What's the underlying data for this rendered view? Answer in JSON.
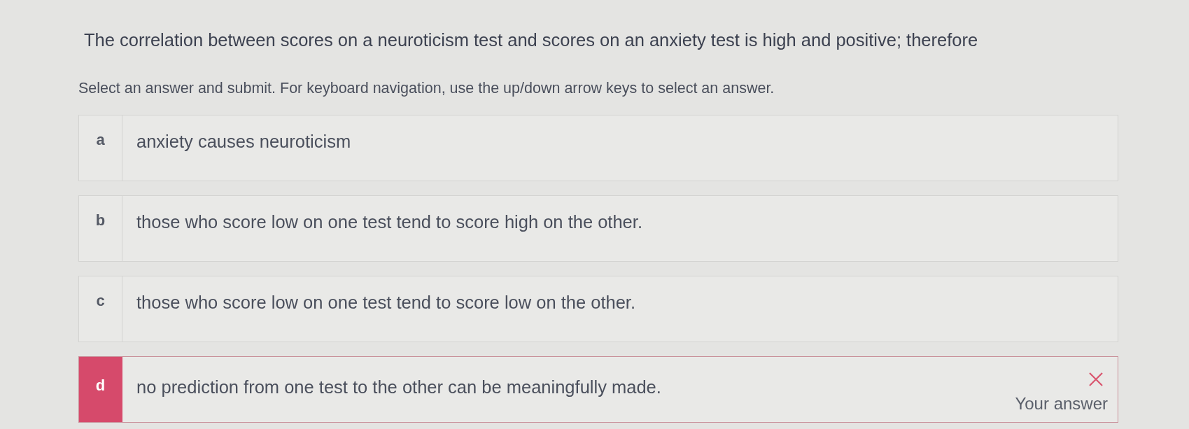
{
  "question": "The correlation between scores on a neuroticism test and scores on an anxiety test is high and positive; therefore",
  "instructions": "Select an answer and submit. For keyboard navigation, use the up/down arrow keys to select an answer.",
  "options": [
    {
      "letter": "a",
      "text": "anxiety causes neuroticism",
      "selected": false
    },
    {
      "letter": "b",
      "text": "those who score low on one test tend to score high on the other.",
      "selected": false
    },
    {
      "letter": "c",
      "text": "those who score low on one test tend to score low on the other.",
      "selected": false
    },
    {
      "letter": "d",
      "text": "no prediction from one test to the other can be meaningfully made.",
      "selected": true,
      "feedback": {
        "kind": "incorrect",
        "label": "Your answer"
      }
    }
  ]
}
